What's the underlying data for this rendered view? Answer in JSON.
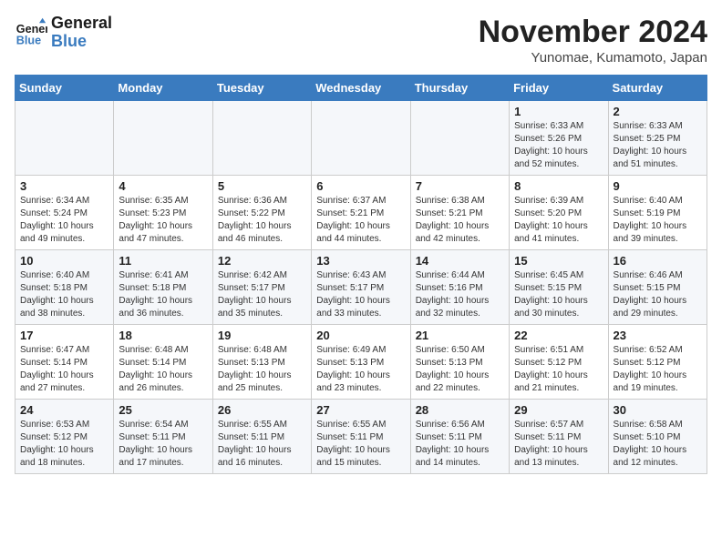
{
  "logo": {
    "line1": "General",
    "line2": "Blue"
  },
  "title": {
    "month_year": "November 2024",
    "location": "Yunomae, Kumamoto, Japan"
  },
  "header": {
    "days": [
      "Sunday",
      "Monday",
      "Tuesday",
      "Wednesday",
      "Thursday",
      "Friday",
      "Saturday"
    ]
  },
  "weeks": [
    {
      "cells": [
        {
          "day": null,
          "info": null
        },
        {
          "day": null,
          "info": null
        },
        {
          "day": null,
          "info": null
        },
        {
          "day": null,
          "info": null
        },
        {
          "day": null,
          "info": null
        },
        {
          "day": "1",
          "info": "Sunrise: 6:33 AM\nSunset: 5:26 PM\nDaylight: 10 hours\nand 52 minutes."
        },
        {
          "day": "2",
          "info": "Sunrise: 6:33 AM\nSunset: 5:25 PM\nDaylight: 10 hours\nand 51 minutes."
        }
      ]
    },
    {
      "cells": [
        {
          "day": "3",
          "info": "Sunrise: 6:34 AM\nSunset: 5:24 PM\nDaylight: 10 hours\nand 49 minutes."
        },
        {
          "day": "4",
          "info": "Sunrise: 6:35 AM\nSunset: 5:23 PM\nDaylight: 10 hours\nand 47 minutes."
        },
        {
          "day": "5",
          "info": "Sunrise: 6:36 AM\nSunset: 5:22 PM\nDaylight: 10 hours\nand 46 minutes."
        },
        {
          "day": "6",
          "info": "Sunrise: 6:37 AM\nSunset: 5:21 PM\nDaylight: 10 hours\nand 44 minutes."
        },
        {
          "day": "7",
          "info": "Sunrise: 6:38 AM\nSunset: 5:21 PM\nDaylight: 10 hours\nand 42 minutes."
        },
        {
          "day": "8",
          "info": "Sunrise: 6:39 AM\nSunset: 5:20 PM\nDaylight: 10 hours\nand 41 minutes."
        },
        {
          "day": "9",
          "info": "Sunrise: 6:40 AM\nSunset: 5:19 PM\nDaylight: 10 hours\nand 39 minutes."
        }
      ]
    },
    {
      "cells": [
        {
          "day": "10",
          "info": "Sunrise: 6:40 AM\nSunset: 5:18 PM\nDaylight: 10 hours\nand 38 minutes."
        },
        {
          "day": "11",
          "info": "Sunrise: 6:41 AM\nSunset: 5:18 PM\nDaylight: 10 hours\nand 36 minutes."
        },
        {
          "day": "12",
          "info": "Sunrise: 6:42 AM\nSunset: 5:17 PM\nDaylight: 10 hours\nand 35 minutes."
        },
        {
          "day": "13",
          "info": "Sunrise: 6:43 AM\nSunset: 5:17 PM\nDaylight: 10 hours\nand 33 minutes."
        },
        {
          "day": "14",
          "info": "Sunrise: 6:44 AM\nSunset: 5:16 PM\nDaylight: 10 hours\nand 32 minutes."
        },
        {
          "day": "15",
          "info": "Sunrise: 6:45 AM\nSunset: 5:15 PM\nDaylight: 10 hours\nand 30 minutes."
        },
        {
          "day": "16",
          "info": "Sunrise: 6:46 AM\nSunset: 5:15 PM\nDaylight: 10 hours\nand 29 minutes."
        }
      ]
    },
    {
      "cells": [
        {
          "day": "17",
          "info": "Sunrise: 6:47 AM\nSunset: 5:14 PM\nDaylight: 10 hours\nand 27 minutes."
        },
        {
          "day": "18",
          "info": "Sunrise: 6:48 AM\nSunset: 5:14 PM\nDaylight: 10 hours\nand 26 minutes."
        },
        {
          "day": "19",
          "info": "Sunrise: 6:48 AM\nSunset: 5:13 PM\nDaylight: 10 hours\nand 25 minutes."
        },
        {
          "day": "20",
          "info": "Sunrise: 6:49 AM\nSunset: 5:13 PM\nDaylight: 10 hours\nand 23 minutes."
        },
        {
          "day": "21",
          "info": "Sunrise: 6:50 AM\nSunset: 5:13 PM\nDaylight: 10 hours\nand 22 minutes."
        },
        {
          "day": "22",
          "info": "Sunrise: 6:51 AM\nSunset: 5:12 PM\nDaylight: 10 hours\nand 21 minutes."
        },
        {
          "day": "23",
          "info": "Sunrise: 6:52 AM\nSunset: 5:12 PM\nDaylight: 10 hours\nand 19 minutes."
        }
      ]
    },
    {
      "cells": [
        {
          "day": "24",
          "info": "Sunrise: 6:53 AM\nSunset: 5:12 PM\nDaylight: 10 hours\nand 18 minutes."
        },
        {
          "day": "25",
          "info": "Sunrise: 6:54 AM\nSunset: 5:11 PM\nDaylight: 10 hours\nand 17 minutes."
        },
        {
          "day": "26",
          "info": "Sunrise: 6:55 AM\nSunset: 5:11 PM\nDaylight: 10 hours\nand 16 minutes."
        },
        {
          "day": "27",
          "info": "Sunrise: 6:55 AM\nSunset: 5:11 PM\nDaylight: 10 hours\nand 15 minutes."
        },
        {
          "day": "28",
          "info": "Sunrise: 6:56 AM\nSunset: 5:11 PM\nDaylight: 10 hours\nand 14 minutes."
        },
        {
          "day": "29",
          "info": "Sunrise: 6:57 AM\nSunset: 5:11 PM\nDaylight: 10 hours\nand 13 minutes."
        },
        {
          "day": "30",
          "info": "Sunrise: 6:58 AM\nSunset: 5:10 PM\nDaylight: 10 hours\nand 12 minutes."
        }
      ]
    }
  ]
}
